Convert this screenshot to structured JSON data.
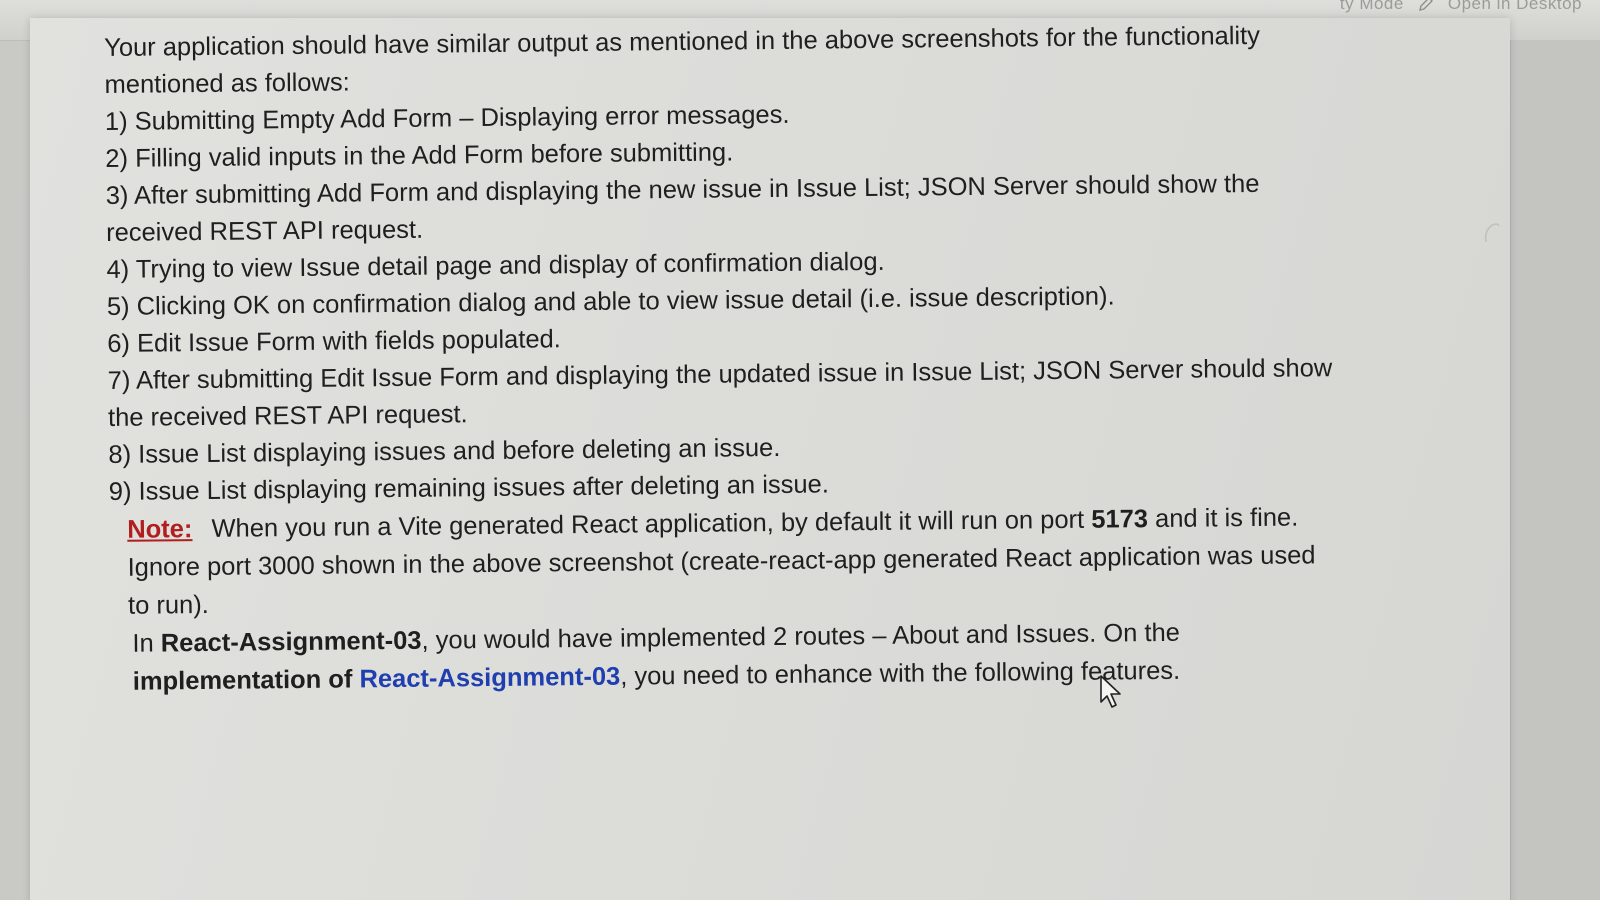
{
  "toolbar": {
    "fragment_left": "ty Mode",
    "open_in_desktop": "Open in Desktop"
  },
  "document": {
    "intro": "Your application should have similar output as mentioned in the above screenshots for the functionality mentioned as follows:",
    "items": [
      "1) Submitting Empty Add Form – Displaying error messages.",
      "2) Filling valid inputs in the Add Form before submitting.",
      "3) After submitting Add Form and displaying the new issue in Issue List; JSON Server should show the received REST API request.",
      "4) Trying to view Issue detail page and display of confirmation dialog.",
      "5) Clicking OK on confirmation dialog and able to view issue detail (i.e. issue description).",
      "6) Edit Issue Form with fields populated.",
      "7) After submitting Edit Issue Form and displaying the updated issue in Issue List; JSON Server should show the received REST API request.",
      "8) Issue List displaying issues and before deleting an issue.",
      "9) Issue List displaying remaining issues after deleting an issue."
    ],
    "note": {
      "label": "Note:",
      "text_before_port": "When you run a Vite generated React application, by default it will run on port",
      "port": "5173",
      "text_after_port": "and it is fine. Ignore port 3000 shown in the above screenshot (create-react-app generated React application was used to run)."
    },
    "routes": {
      "prefix": "In",
      "assignment_name": "React-Assignment-03",
      "middle": ", you would have implemented 2 routes – About and Issues. On the",
      "impl_prefix": "implementation of",
      "link_text": "React-Assignment-03",
      "suffix": ", you need to enhance with the following features."
    }
  },
  "colors": {
    "note_label": "#b01e1e",
    "link": "#1f3fb0",
    "text": "#1f1f1f",
    "page_bg": "#dedeDB"
  }
}
